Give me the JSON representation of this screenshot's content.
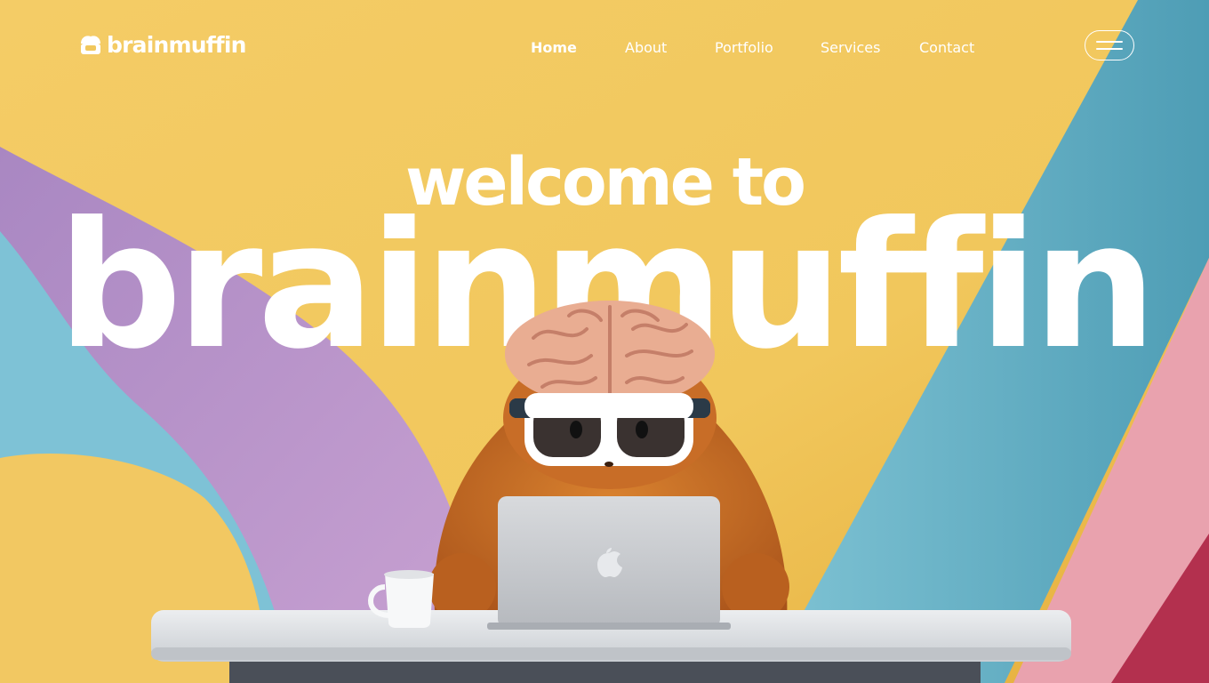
{
  "brand": {
    "logo_text": "brainmuffin"
  },
  "nav": {
    "links": [
      {
        "label": "Home"
      },
      {
        "label": "About"
      },
      {
        "label": "Portfolio"
      },
      {
        "label": "Services"
      },
      {
        "label": "Contact"
      }
    ],
    "menu_icon": "hamburger-icon"
  },
  "hero": {
    "welcome": "welcome to",
    "brand_name": "brainmuffin"
  },
  "colors": {
    "background_yellow": "#f0c558",
    "purple": "#b795c9",
    "blue": "#6ab4cc",
    "pink": "#e79aa8",
    "fur": "#c46a25",
    "white": "#ffffff"
  }
}
